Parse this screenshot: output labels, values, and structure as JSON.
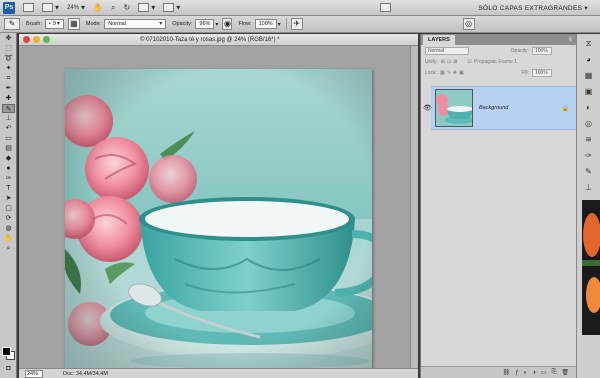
{
  "app": {
    "logo_text": "Ps",
    "zoom_value": "24%",
    "workspace_label": "SÓLO CAPAS EXTRAGRANDES",
    "workspace_arrow": "▾"
  },
  "options": {
    "brush_label": "Brush:",
    "brush_size": "9",
    "mode_label": "Mode:",
    "mode_value": "Normal",
    "opacity_label": "Opacity:",
    "opacity_value": "96%",
    "flow_label": "Flow:",
    "flow_value": "100%",
    "arrow": "▾"
  },
  "document": {
    "title": "© 07102010-Taza té y rosas.jpg @ 24% (RGB/16*) *",
    "status_zoom": "24%",
    "status_info": "Doc: 34,4M/34,4M"
  },
  "layers_panel": {
    "tab_label": "LAYERS",
    "menu_glyph": "≡",
    "blend_mode": "Normal",
    "opacity_label": "Opacity:",
    "opacity_value": "100%",
    "unify_label": "Unify:",
    "propagate_label": "Propagate Frame 1",
    "lock_label": "Lock:",
    "fill_label": "Fill:",
    "fill_value": "100%",
    "layer_name": "Background",
    "lock_glyph": "🔒"
  },
  "colors": {
    "selected_layer": "#b7d1f2",
    "photo_teal": "#7fc3bf",
    "rose_pink": "#f08ea0"
  }
}
